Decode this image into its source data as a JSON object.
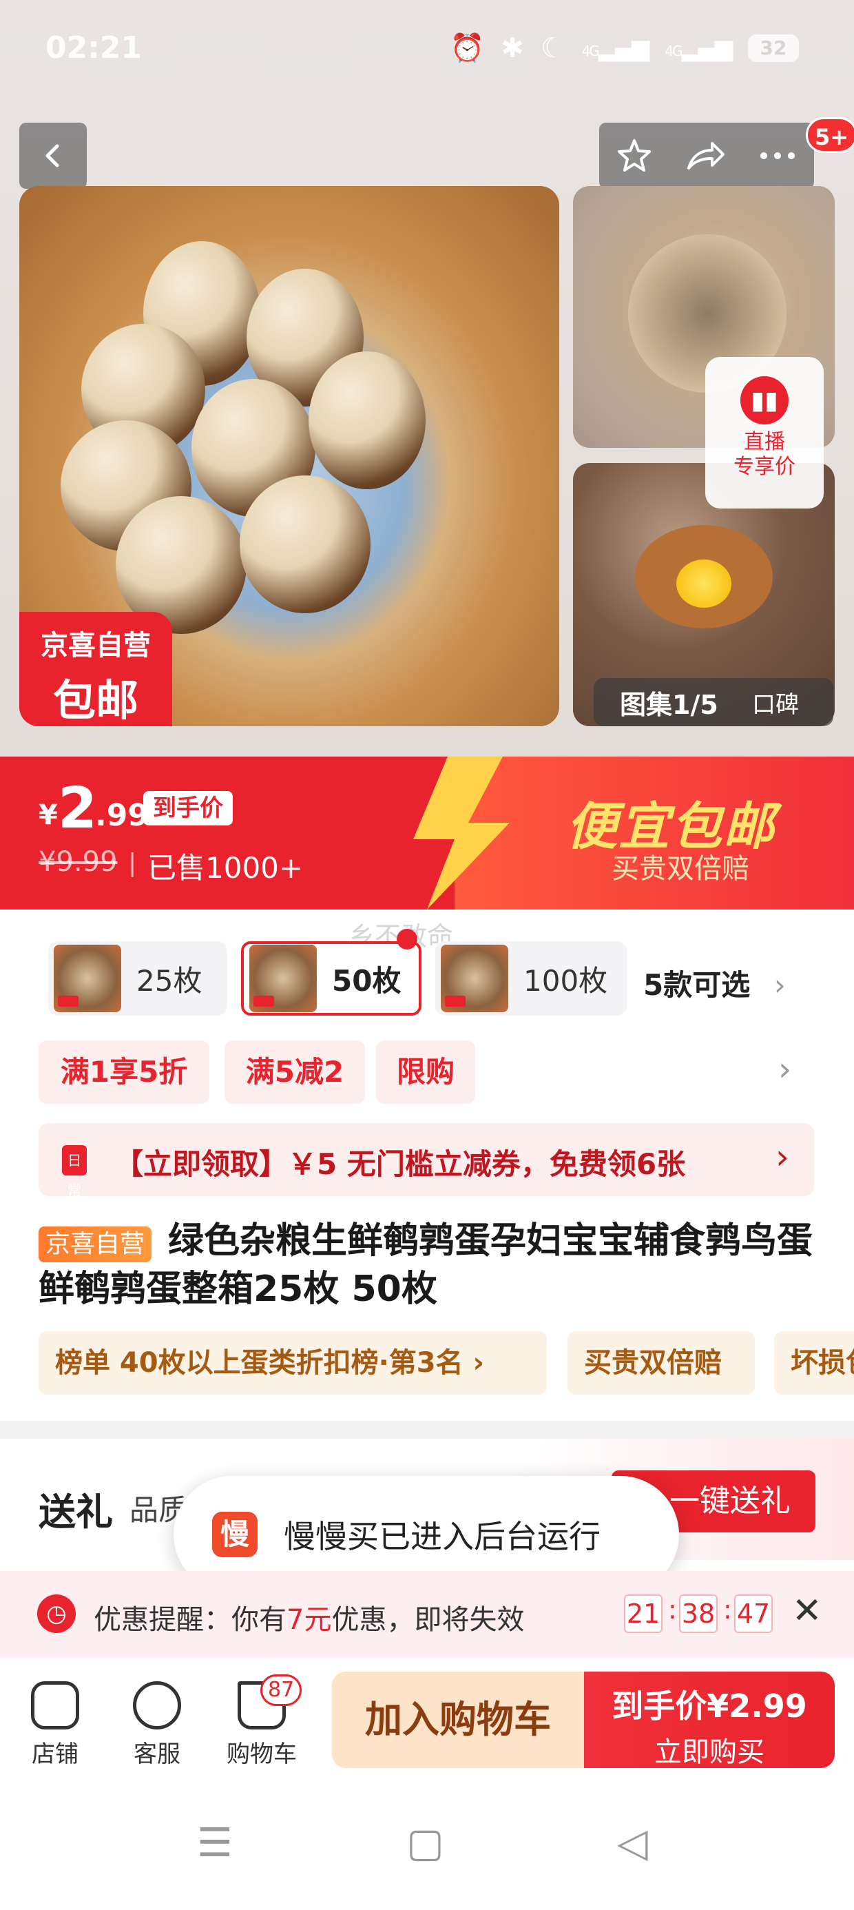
{
  "status_bar": {
    "time": "02:21",
    "battery": "32",
    "network1": "4G",
    "network2": "4G"
  },
  "gallery": {
    "top_badge": "5+",
    "self_tag_line1": "京喜自营",
    "self_tag_line2": "包邮",
    "live_label": "直播\n专享价",
    "live_line1": "直播",
    "live_line2": "专享价",
    "album_label": "图集1/5",
    "review_label": "口碑"
  },
  "price": {
    "currency": "¥",
    "integer": "2",
    "decimal": ".99",
    "price_tag": "到手价",
    "original": "¥9.99",
    "separator": "|",
    "sold": "已售1000+",
    "slogan": "便宜包邮",
    "slogan_sub": "买贵双倍赔",
    "watermark": "乡不敢命"
  },
  "variants": {
    "items": [
      {
        "label": "25枚",
        "selected": false
      },
      {
        "label": "50枚",
        "selected": true
      },
      {
        "label": "100枚",
        "selected": false
      }
    ],
    "more": "5款可选",
    "more_arrow": "›"
  },
  "promos": {
    "tags": [
      "满1享5折",
      "满5减2",
      "限购"
    ],
    "arrow": "›",
    "coupon_icon": "日常",
    "coupon_text": "【立即领取】￥5 无门槛立减券，免费领6张",
    "coupon_arrow": "›"
  },
  "product": {
    "self_tag": "京喜自营",
    "title": "绿色杂粮生鲜鹌鹑蛋孕妇宝宝辅食鹑鸟蛋鲜鹌鹑蛋整箱25枚 50枚",
    "pills": [
      "榜单  40枚以上蛋类折扣榜·第3名 ›",
      "买贵双倍赔",
      "坏损包赔"
    ]
  },
  "gift": {
    "title": "送礼",
    "subtitle": "品质",
    "button": "一键送礼"
  },
  "toast": {
    "icon": "慢",
    "text": "慢慢买已进入后台运行"
  },
  "reminder": {
    "prefix": "优惠提醒：你有",
    "amount": "7元",
    "suffix": "优惠，即将失效",
    "hh": "21",
    "mm": "38",
    "ss": "47",
    "close": "✕"
  },
  "bottom_bar": {
    "store": "店铺",
    "service": "客服",
    "cart": "购物车",
    "cart_count": "87",
    "add_to_cart": "加入购物车",
    "buy_price": "到手价¥2.99",
    "buy_now": "立即购买"
  },
  "nav": {
    "menu": "☰",
    "home": "▢",
    "back": "◁"
  },
  "colors": {
    "accent": "#e8232d",
    "gold": "#ffe36b",
    "orange_tag": "#ff7a2d"
  }
}
